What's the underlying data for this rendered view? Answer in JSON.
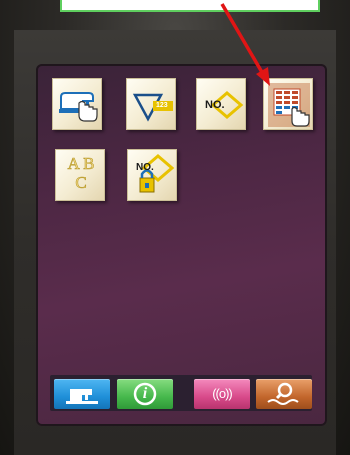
{
  "colors": {
    "screen_background": "#4c2743",
    "icon_face": "#f4ecd2",
    "icon_accent": "#e8c200",
    "button_sewing": "#1f8fd8",
    "button_info": "#46b84c",
    "button_signal": "#d84a8a",
    "button_search": "#c2662c",
    "annotation_arrow": "#e01515",
    "banner_border": "#5fcf5f"
  },
  "grid_icons": [
    {
      "icon": "sewing-machine-hand-icon",
      "text": ""
    },
    {
      "icon": "triangle-counter-icon",
      "text": "123"
    },
    {
      "icon": "number-pattern-icon",
      "text": "NO."
    },
    {
      "icon": "pattern-list-hand-icon",
      "text": ""
    },
    {
      "icon": "abc-letters-icon",
      "text": "A B C"
    },
    {
      "icon": "number-lock-icon",
      "text": "NO."
    }
  ],
  "bottom_bar": [
    {
      "icon": "sewing-machine-icon"
    },
    {
      "icon": "info-icon",
      "text": "i"
    },
    {
      "icon": "signal-waves-icon",
      "text": "((o))"
    },
    {
      "icon": "search-icon"
    }
  ]
}
